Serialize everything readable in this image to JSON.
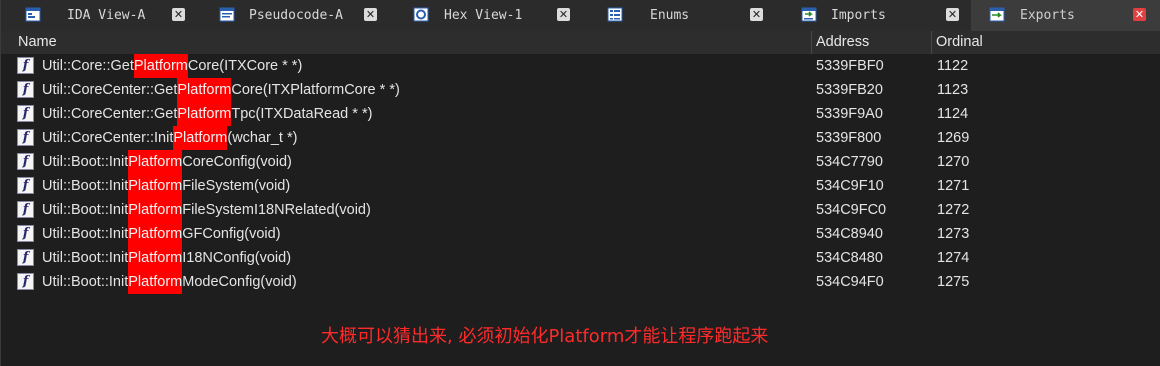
{
  "tabs": [
    {
      "label": "IDA View-A",
      "icon": "ida-view-icon",
      "active": false
    },
    {
      "label": "Pseudocode-A",
      "icon": "pseudocode-icon",
      "active": false
    },
    {
      "label": "Hex View-1",
      "icon": "hex-view-icon",
      "active": false
    },
    {
      "label": "Enums",
      "icon": "enums-icon",
      "active": false
    },
    {
      "label": "Imports",
      "icon": "imports-icon",
      "active": false
    },
    {
      "label": "Exports",
      "icon": "exports-icon",
      "active": true
    }
  ],
  "columns": {
    "name": "Name",
    "address": "Address",
    "ordinal": "Ordinal"
  },
  "highlight_term": "Platform",
  "exports": [
    {
      "prefix": "Util::Core::Get",
      "match": "Platform",
      "suffix": "Core(ITXCore * *)",
      "address": "5339FBF0",
      "ordinal": "1122"
    },
    {
      "prefix": "Util::CoreCenter::Get",
      "match": "Platform",
      "suffix": "Core(ITXPlatformCore * *)",
      "address": "5339FB20",
      "ordinal": "1123"
    },
    {
      "prefix": "Util::CoreCenter::Get",
      "match": "Platform",
      "suffix": "Tpc(ITXDataRead * *)",
      "address": "5339F9A0",
      "ordinal": "1124"
    },
    {
      "prefix": "Util::CoreCenter::Init",
      "match": "Platform",
      "suffix": "(wchar_t *)",
      "address": "5339F800",
      "ordinal": "1269"
    },
    {
      "prefix": "Util::Boot::Init",
      "match": "Platform",
      "suffix": "CoreConfig(void)",
      "address": "534C7790",
      "ordinal": "1270"
    },
    {
      "prefix": "Util::Boot::Init",
      "match": "Platform",
      "suffix": "FileSystem(void)",
      "address": "534C9F10",
      "ordinal": "1271"
    },
    {
      "prefix": "Util::Boot::Init",
      "match": "Platform",
      "suffix": "FileSystemI18NRelated(void)",
      "address": "534C9FC0",
      "ordinal": "1272"
    },
    {
      "prefix": "Util::Boot::Init",
      "match": "Platform",
      "suffix": "GFConfig(void)",
      "address": "534C8940",
      "ordinal": "1273"
    },
    {
      "prefix": "Util::Boot::Init",
      "match": "Platform",
      "suffix": "I18NConfig(void)",
      "address": "534C8480",
      "ordinal": "1274"
    },
    {
      "prefix": "Util::Boot::Init",
      "match": "Platform",
      "suffix": "ModeConfig(void)",
      "address": "534C94F0",
      "ordinal": "1275"
    }
  ],
  "annotation": "大概可以猜出来, 必须初始化Platform才能让程序跑起来",
  "colors": {
    "highlight": "#ff0000",
    "annotation": "#ff2a2a",
    "active_close": "#e04040"
  }
}
